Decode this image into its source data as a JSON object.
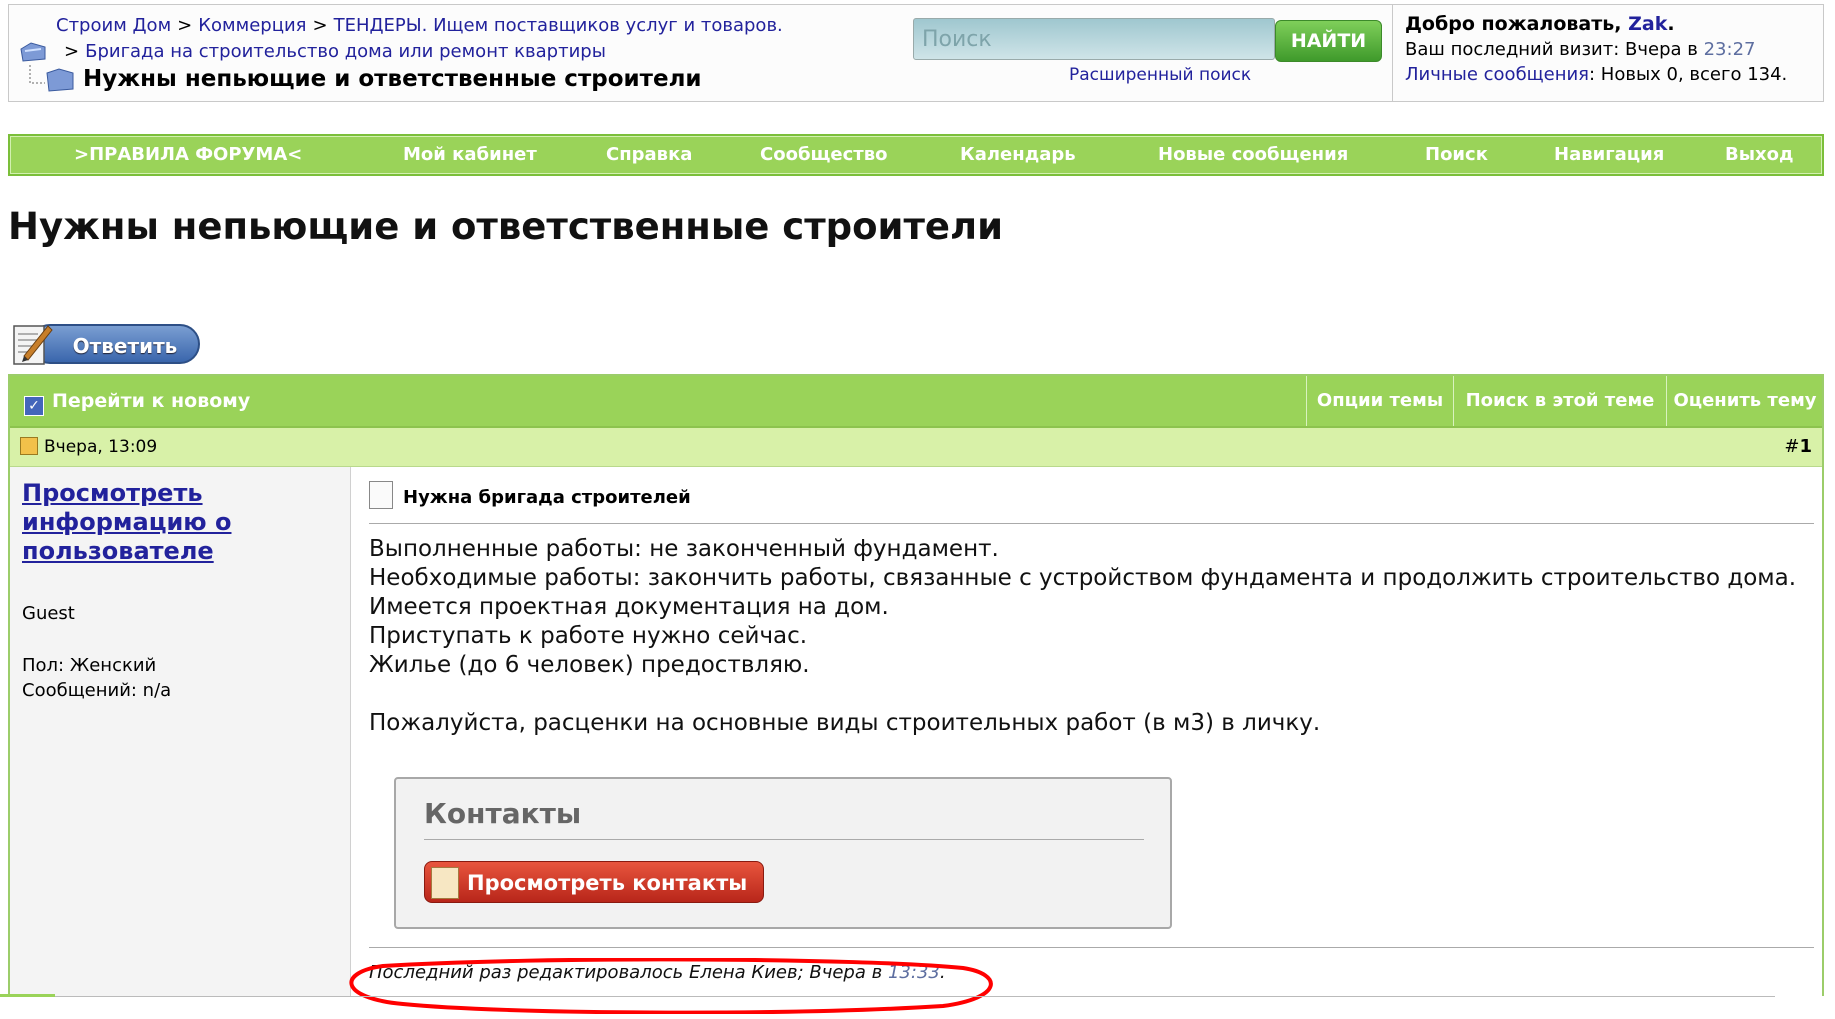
{
  "breadcrumb": {
    "items": [
      "Строим Дом",
      "Коммерция",
      "ТЕНДЕРЫ. Ищем поставщиков услуг и товаров."
    ],
    "item2": "Бригада на строительство дома или ремонт квартиры",
    "separator": ">",
    "current": "Нужны непьющие и ответственные строители"
  },
  "search": {
    "placeholder": "Поиск",
    "button": "НАЙТИ",
    "advanced": "Расширенный поиск"
  },
  "welcome": {
    "greeting": "Добро пожаловать,",
    "username": "Zak",
    "dot": ".",
    "last_visit_label": "Ваш последний визит: Вчера в",
    "last_visit_time": "23:27",
    "pm_label": "Личные сообщения",
    "pm_value": ": Новых 0, всего 134."
  },
  "navbar": {
    "items": [
      ">ПРАВИЛА ФОРУМА<",
      "Мой кабинет",
      "Справка",
      "Сообщество",
      "Календарь",
      "Новые сообщения",
      "Поиск",
      "Навигация",
      "Выход"
    ]
  },
  "page_title": "Нужны непьющие и ответственные строители",
  "reply_button": "Ответить",
  "thread_bar": {
    "goto_new": "Перейти к новому",
    "options": [
      "Опции темы",
      "Поиск в этой теме",
      "Оценить тему"
    ]
  },
  "post": {
    "date": "Вчера, 13:09",
    "number_prefix": "#",
    "number": "1",
    "user_link": "Просмотреть информацию о пользователе",
    "user_role": "Guest",
    "gender": "Пол: Женский",
    "posts_count": "Сообщений: n/a",
    "title": "Нужна бригада строителей",
    "lines": [
      "Выполненные работы: не законченный фундамент.",
      "Необходимые работы: закончить работы, связанные с устройством фундамента и продолжить строительство дома.",
      "Имеется проектная документация на дом.",
      "Приступать к работе нужно сейчас.",
      "Жилье (до 6 человек) предоствляю.",
      "",
      "Пожалуйста, расценки на основные виды строительных работ (в м3) в личку."
    ],
    "contacts_heading": "Контакты",
    "contacts_button": "Просмотреть контакты",
    "edited_label": "Последний раз редактировалось Елена Киев; Вчера в",
    "edited_time": "13:33",
    "edited_end": "."
  },
  "colors": {
    "nav_green": "#9ad359",
    "row_green": "#d8f1a8",
    "link_blue": "#22229c",
    "annotation_red": "#ff0000"
  }
}
